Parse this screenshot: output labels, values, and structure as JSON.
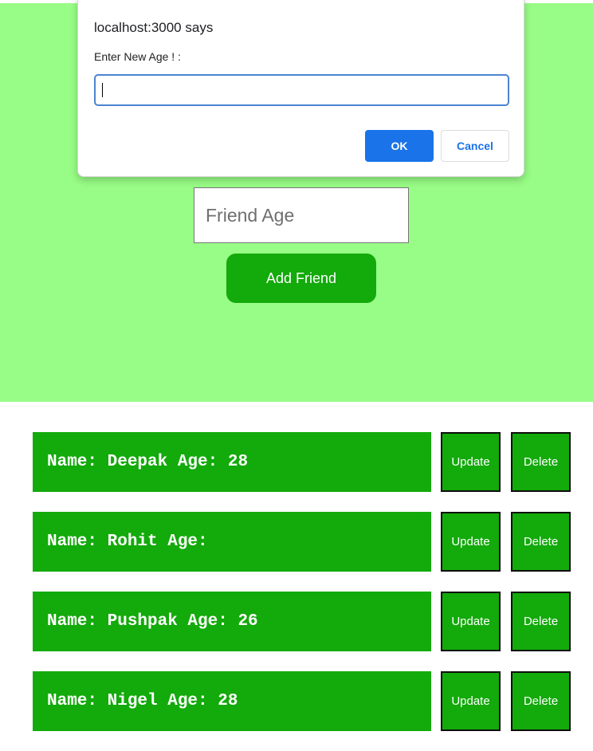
{
  "form": {
    "age_placeholder": "Friend Age",
    "add_label": "Add Friend"
  },
  "friends": [
    {
      "text": "Name: Deepak Age: 28",
      "update_label": "Update",
      "delete_label": "Delete"
    },
    {
      "text": "Name: Rohit Age:",
      "update_label": "Update",
      "delete_label": "Delete"
    },
    {
      "text": "Name: Pushpak Age: 26",
      "update_label": "Update",
      "delete_label": "Delete"
    },
    {
      "text": "Name: Nigel Age: 28",
      "update_label": "Update",
      "delete_label": "Delete"
    }
  ],
  "dialog": {
    "title": "localhost:3000 says",
    "message": "Enter New Age ! :",
    "input_value": "",
    "ok_label": "OK",
    "cancel_label": "Cancel"
  },
  "colors": {
    "panel_background": "#98fd86",
    "primary_green": "#13aa0b",
    "dialog_accent": "#1a73e8"
  }
}
